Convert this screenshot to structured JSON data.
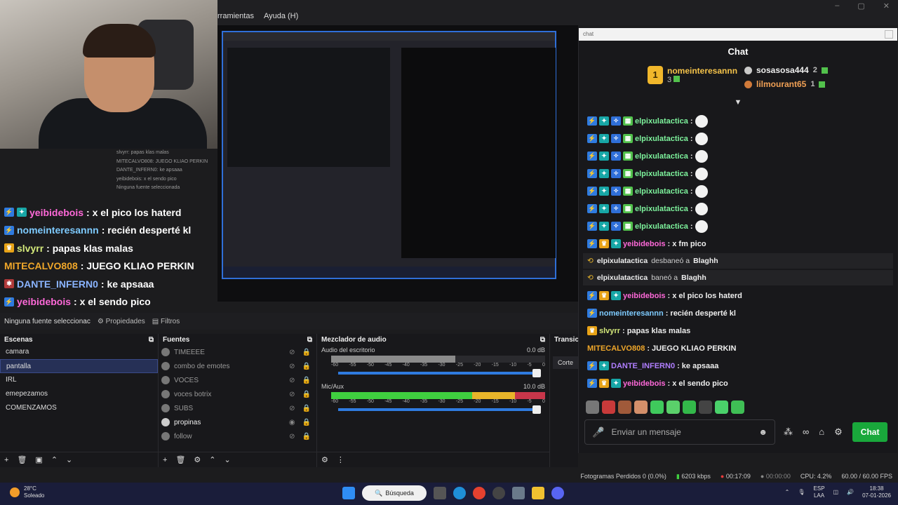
{
  "window": {
    "menu": [
      "rramientas",
      "Ayuda (H)"
    ]
  },
  "preview_overlay_chat": [
    {
      "user": "yeibidebois",
      "text": ": x el pico los haterd",
      "color": "#ff69d9"
    },
    {
      "user": "nomeinteresannn",
      "text": ": recién desperté kl",
      "color": "#7ecbff"
    },
    {
      "user": "slvyrr",
      "text": ": papas klas malas",
      "color": "#d3e87a"
    },
    {
      "user": "MITECALVO808",
      "text": ": JUEGO KLIAO PERKIN",
      "color": "#f0a72a"
    },
    {
      "user": "DANTE_INFERN0",
      "text": ": ke apsaaa",
      "color": "#8ab4ff"
    },
    {
      "user": "yeibidebois",
      "text": ": x el sendo pico",
      "color": "#ff69d9"
    }
  ],
  "faint_overlay": [
    "slvyrr: papas klas malas",
    "MITECALVO808: JUEGO KLIAO PERKIN",
    "DANTE_INFERN0: ke apsaaa",
    "yeibidebois: x el sendo pico",
    "Ninguna fuente seleccionada"
  ],
  "midbar": {
    "no_source": "Ninguna fuente seleccionac",
    "properties": "Propiedades",
    "filters": "Filtros"
  },
  "scenes": {
    "title": "Escenas",
    "items": [
      "camara",
      "pantalla",
      "IRL",
      "emepezamos",
      "COMENZAMOS"
    ],
    "selected": "pantalla"
  },
  "sources": {
    "title": "Fuentes",
    "items": [
      "TIMEEEE",
      "combo de emotes",
      "VOCES",
      "voces botrix",
      "SUBS",
      "propinas",
      "follow"
    ],
    "visible": "propinas"
  },
  "mixer": {
    "title": "Mezclador de audio",
    "channels": [
      {
        "name": "Audio del escritorio",
        "db": "0.0 dB"
      },
      {
        "name": "Mic/Aux",
        "db": "10.0 dB"
      }
    ],
    "scale": [
      "-60",
      "-55",
      "-50",
      "-45",
      "-40",
      "-35",
      "-30",
      "-25",
      "-20",
      "-15",
      "-10",
      "-5",
      "0"
    ]
  },
  "transitions": {
    "title": "Transici",
    "cut": "Corte"
  },
  "chat": {
    "window_title": "chat",
    "title": "Chat",
    "leaderboard": {
      "first": {
        "name": "nomeinteresannn",
        "count": "3",
        "rank": "1"
      },
      "second": {
        "name": "sosasosa444",
        "count": "2"
      },
      "third": {
        "name": "lilmourant65",
        "count": "1"
      }
    },
    "messages": [
      {
        "type": "msg",
        "user": "elpixulatactica",
        "text": ":",
        "cls": "uc-elp",
        "skull": true
      },
      {
        "type": "msg",
        "user": "elpixulatactica",
        "text": ":",
        "cls": "uc-elp",
        "skull": true
      },
      {
        "type": "msg",
        "user": "elpixulatactica",
        "text": ":",
        "cls": "uc-elp",
        "skull": true
      },
      {
        "type": "msg",
        "user": "elpixulatactica",
        "text": ":",
        "cls": "uc-elp",
        "skull": true
      },
      {
        "type": "msg",
        "user": "elpixulatactica",
        "text": ":",
        "cls": "uc-elp",
        "skull": true
      },
      {
        "type": "msg",
        "user": "elpixulatactica",
        "text": ":",
        "cls": "uc-elp",
        "skull": true
      },
      {
        "type": "msg",
        "user": "elpixulatactica",
        "text": ":",
        "cls": "uc-elp",
        "skull": true
      },
      {
        "type": "msg",
        "user": "yeibidebois",
        "text": ": x fm pico",
        "cls": "uc-yei"
      },
      {
        "type": "notice",
        "actor": "elpixulatactica",
        "action": "desbaneó a",
        "target": "Blaghh"
      },
      {
        "type": "notice",
        "actor": "elpixulatactica",
        "action": "baneó a",
        "target": "Blaghh"
      },
      {
        "type": "msg",
        "user": "yeibidebois",
        "text": ": x el pico los haterd",
        "cls": "uc-yei"
      },
      {
        "type": "msg",
        "user": "nomeinteresannn",
        "text": ": recién desperté kl",
        "cls": "uc-nom"
      },
      {
        "type": "msg",
        "user": "slvyrr",
        "text": ": papas klas malas",
        "cls": "uc-slv"
      },
      {
        "type": "msg",
        "user": "MITECALVO808",
        "text": ": JUEGO KLIAO PERKIN",
        "cls": "uc-mit"
      },
      {
        "type": "msg",
        "user": "DANTE_INFERN0",
        "text": ": ke apsaaa",
        "cls": "uc-dan"
      },
      {
        "type": "msg",
        "user": "yeibidebois",
        "text": ": x el sendo pico",
        "cls": "uc-yei"
      }
    ],
    "input_placeholder": "Enviar un mensaje",
    "send_label": "Chat"
  },
  "status": {
    "dropped": "Fotogramas Perdidos 0 (0.0%)",
    "bitrate": "6203 kbps",
    "live_time": "00:17:09",
    "rec_time": "00:00:00",
    "cpu": "CPU: 4.2%",
    "fps": "60.00 / 60.00 FPS"
  },
  "taskbar": {
    "temp": "28°C",
    "weather": "Soleado",
    "search": "Búsqueda",
    "lang": "ESP",
    "lang2": "LAA",
    "time": "18:38",
    "date": "07-01-2026"
  }
}
